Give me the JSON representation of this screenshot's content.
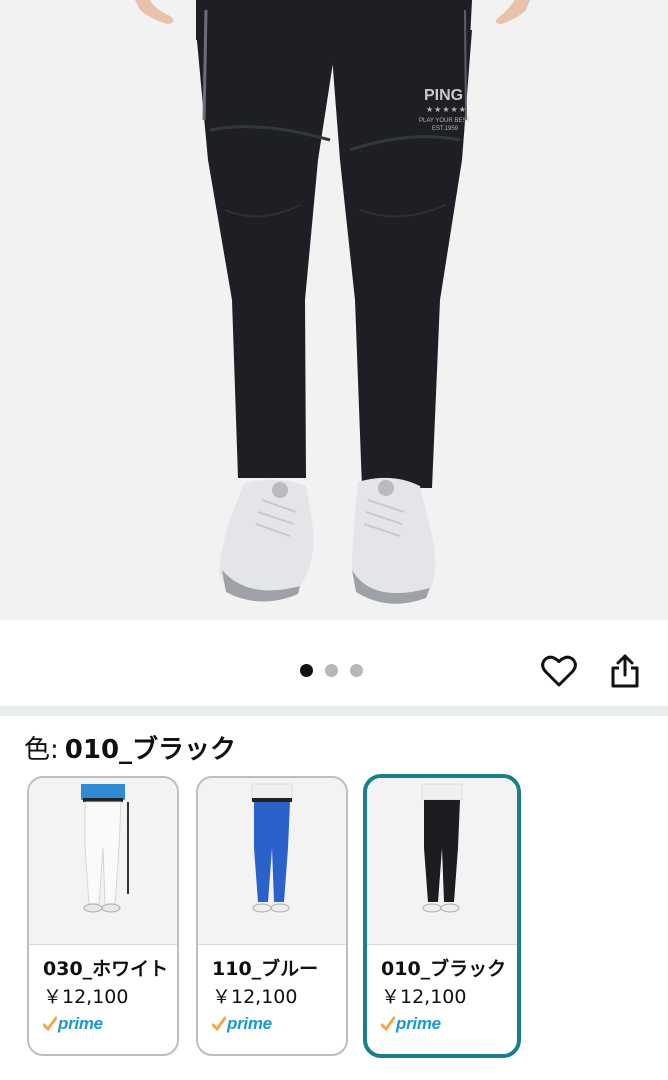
{
  "hero": {
    "logo_text": "PING",
    "logo_tagline_1": "PLAY YOUR BEST",
    "logo_tagline_2": "EST.1959",
    "page_count": 3,
    "active_page": 1
  },
  "actions": {
    "favorite_icon": "heart-icon",
    "share_icon": "share-icon"
  },
  "variation": {
    "label": "色:",
    "selected_value": "010_ブラック",
    "options": [
      {
        "name": "030_ホワイト",
        "price": "￥12,100",
        "badge": "prime",
        "color": "#f4f4f4",
        "selected": false
      },
      {
        "name": "110_ブルー",
        "price": "￥12,100",
        "badge": "prime",
        "color": "#2a62c9",
        "selected": false
      },
      {
        "name": "010_ブラック",
        "price": "￥12,100",
        "badge": "prime",
        "color": "#1c1d21",
        "selected": true
      }
    ]
  },
  "colors": {
    "selected_border": "#1a7f8c",
    "prime_blue": "#1a98d5",
    "prime_check": "#f3a847"
  }
}
